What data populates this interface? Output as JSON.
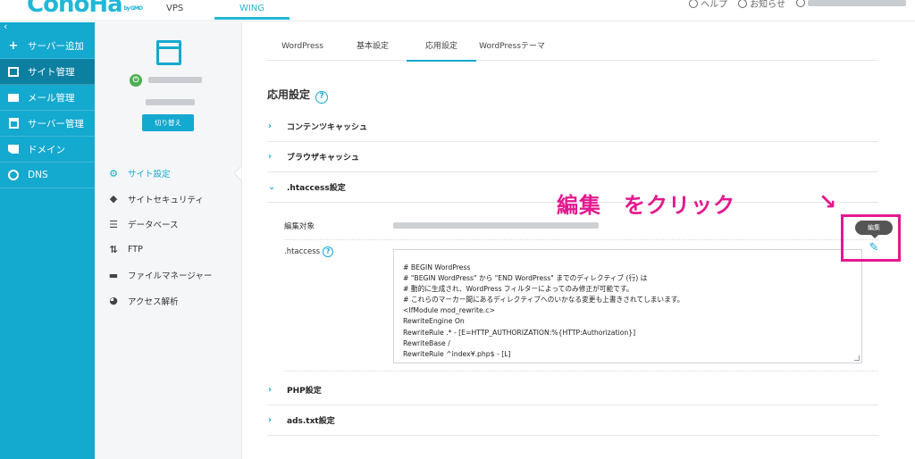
{
  "brand": {
    "logo_text": "ConoHa",
    "logo_sub": "by GMO"
  },
  "topnav": {
    "tabs": [
      "VPS",
      "WING"
    ],
    "active": "WING",
    "help": "ヘルプ",
    "notice": "お知らせ"
  },
  "sidebar": {
    "collapse": "‹",
    "items": [
      {
        "label": "サーバー追加",
        "icon": "plus-icon"
      },
      {
        "label": "サイト管理",
        "icon": "window-icon",
        "active": true
      },
      {
        "label": "メール管理",
        "icon": "mail-icon"
      },
      {
        "label": "サーバー管理",
        "icon": "server-icon"
      },
      {
        "label": "ドメイン",
        "icon": "domain-icon"
      },
      {
        "label": "DNS",
        "icon": "globe-icon"
      }
    ]
  },
  "site_panel": {
    "switch_label": "切り替え",
    "menu": [
      {
        "label": "サイト設定",
        "icon": "gear-icon",
        "active": true
      },
      {
        "label": "サイトセキュリティ",
        "icon": "shield-icon"
      },
      {
        "label": "データベース",
        "icon": "database-icon"
      },
      {
        "label": "FTP",
        "icon": "ftp-icon"
      },
      {
        "label": "ファイルマネージャー",
        "icon": "folder-icon"
      },
      {
        "label": "アクセス解析",
        "icon": "pie-chart-icon"
      }
    ]
  },
  "content": {
    "tabs": [
      "WordPress",
      "基本設定",
      "応用設定",
      "WordPressテーマ"
    ],
    "active_tab": "応用設定",
    "page_title": "応用設定",
    "sections": {
      "contents_cache": "コンテンツキャッシュ",
      "browser_cache": "ブラウザキャッシュ",
      "htaccess": ".htaccess設定",
      "php": "PHP設定",
      "ads": "ads.txt設定"
    },
    "edit_target_label": "編集対象",
    "htaccess_label": ".htaccess",
    "htaccess_lines": [
      "# BEGIN WordPress",
      "# \"BEGIN WordPress\" から \"END WordPress\" までのディレクティブ (行) は",
      "# 動的に生成され、WordPress フィルターによってのみ修正が可能です。",
      "# これらのマーカー間にあるディレクティブへのいかなる変更も上書きされてしまいます。",
      "<IfModule mod_rewrite.c>",
      "RewriteEngine On",
      "RewriteRule .* - [E=HTTP_AUTHORIZATION:%{HTTP:Authorization}]",
      "RewriteBase /",
      "RewriteRule ^index¥.php$ - [L]"
    ],
    "edit_tooltip": "編集"
  },
  "annotation": {
    "text": "編集　をクリック",
    "arrow": "↘",
    "color": "#e4188f"
  },
  "colors": {
    "accent": "#14a9cf",
    "sidebar_active": "#0d7fa0",
    "annotation": "#e4188f"
  }
}
